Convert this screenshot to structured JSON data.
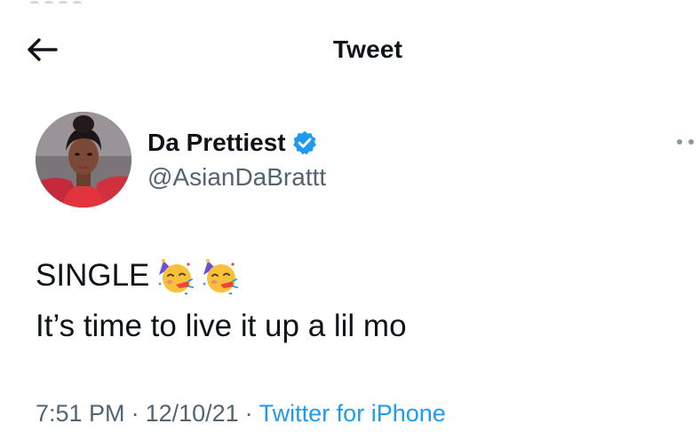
{
  "header": {
    "title": "Tweet",
    "back_icon": "arrow-left-icon"
  },
  "author": {
    "name": "Da Prettiest",
    "handle": "@AsianDaBrattt",
    "verified": true,
    "verified_icon": "verified-badge-icon",
    "avatar": "profile-photo"
  },
  "tweet": {
    "line1": "SINGLE",
    "line1_emojis": [
      "partying-face-emoji",
      "partying-face-emoji"
    ],
    "line2": "It’s time to live it up a lil mo"
  },
  "meta": {
    "time": "7:51 PM",
    "separator": "·",
    "date": "12/10/21",
    "source": "Twitter for iPhone"
  },
  "colors": {
    "text": "#0f1419",
    "secondary": "#536471",
    "accent": "#1d9bf0"
  }
}
